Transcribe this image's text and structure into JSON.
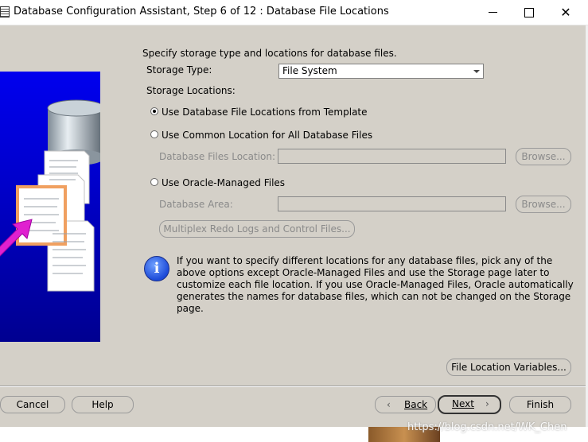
{
  "window": {
    "title": "Database Configuration Assistant, Step 6 of 12 : Database File Locations"
  },
  "content": {
    "intro": "Specify storage type and locations for database files.",
    "storage_type_label": "Storage Type:",
    "storage_type_value": "File System",
    "storage_locations_label": "Storage Locations:",
    "options": {
      "template": "Use Database File Locations from Template",
      "common": "Use Common Location for All Database Files",
      "omf": "Use Oracle-Managed Files"
    },
    "selected_option": "template",
    "db_files_location_label": "Database Files Location:",
    "db_files_location_value": "",
    "db_area_label": "Database Area:",
    "db_area_value": "",
    "browse_label": "Browse...",
    "multiplex_label": "Multiplex Redo Logs and Control Files...",
    "info_text": "If you want to specify different locations for any database files, pick any of the above options except Oracle-Managed Files and use the Storage page later to customize each file location. If you use Oracle-Managed Files, Oracle automatically generates the names for database files, which can not be changed on the Storage page.",
    "file_location_variables_label": "File Location Variables..."
  },
  "footer": {
    "cancel": "Cancel",
    "help": "Help",
    "back": "Back",
    "next": "Next",
    "finish": "Finish"
  },
  "watermark": "https://blog.csdn.net/WK_Chen",
  "colors": {
    "dialog_bg": "#d4d0c8",
    "art_blue": "#0000cc",
    "info_blue": "#1c4ad8"
  }
}
